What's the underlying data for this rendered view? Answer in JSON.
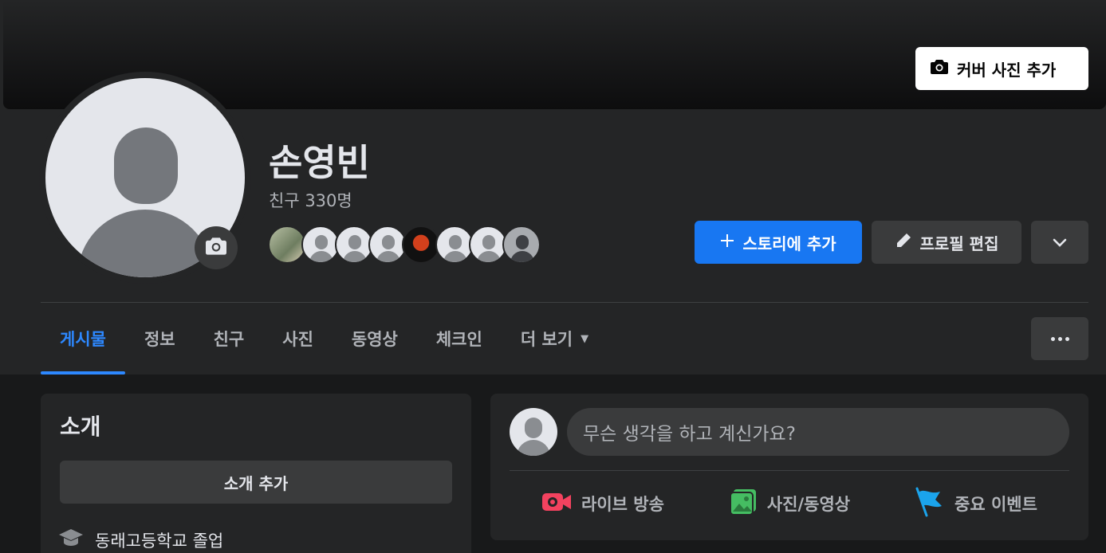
{
  "cover": {
    "add_cover_label": "커버 사진 추가"
  },
  "profile": {
    "name": "손영빈",
    "friends_count": "친구 330명"
  },
  "actions": {
    "add_story_label": "스토리에 추가",
    "edit_profile_label": "프로필 편집"
  },
  "tabs": [
    {
      "label": "게시물"
    },
    {
      "label": "정보"
    },
    {
      "label": "친구"
    },
    {
      "label": "사진"
    },
    {
      "label": "동영상"
    },
    {
      "label": "체크인"
    },
    {
      "label": "더 보기"
    }
  ],
  "intro": {
    "title": "소개",
    "add_intro_label": "소개 추가",
    "education": "동래고등학교 졸업"
  },
  "composer": {
    "placeholder": "무슨 생각을 하고 계신가요?",
    "live_label": "라이브 방송",
    "photo_label": "사진/동영상",
    "event_label": "중요 이벤트"
  },
  "colors": {
    "accent": "#1877f2",
    "active_tab": "#2d88ff",
    "live_icon": "#f3425f",
    "photo_icon": "#45bd62",
    "event_icon": "#1ba4ec"
  }
}
